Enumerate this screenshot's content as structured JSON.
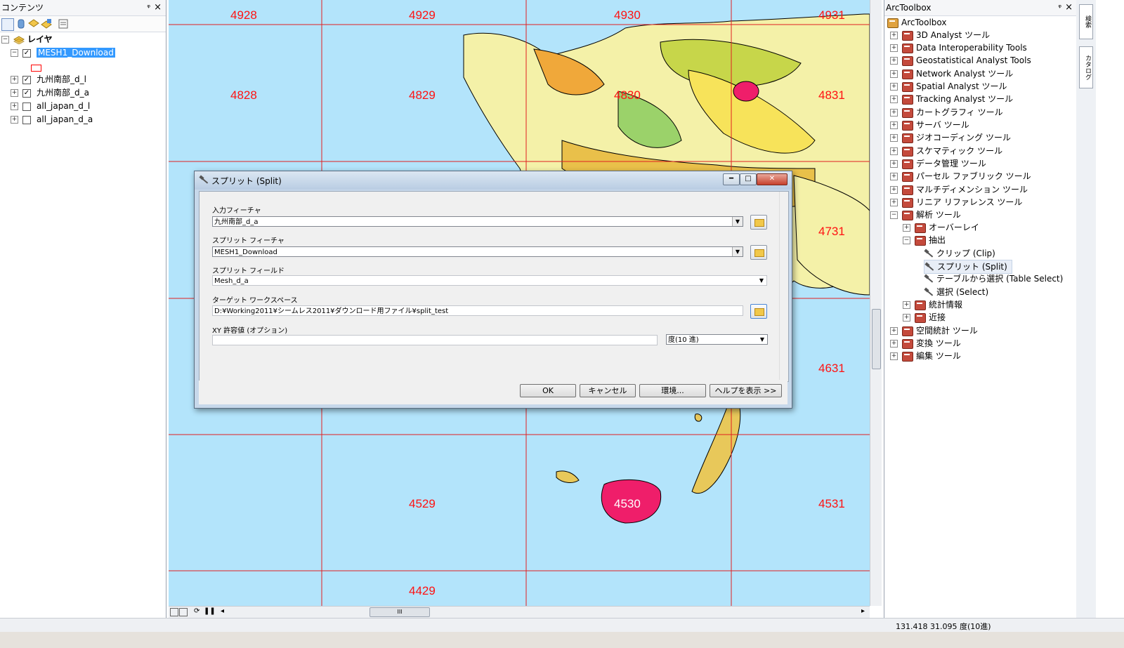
{
  "contents": {
    "title": "コンテンツ",
    "pin": "ᵠ",
    "close": "×",
    "root_label": "レイヤ",
    "layers": [
      {
        "label": "MESH1_Download",
        "checked": "✓",
        "expander": "−",
        "selected": true
      },
      {
        "label": "九州南部_d_l",
        "checked": "✓",
        "expander": "+"
      },
      {
        "label": "九州南部_d_a",
        "checked": "✓",
        "expander": "+"
      },
      {
        "label": "all_japan_d_l",
        "checked": "",
        "expander": "+"
      },
      {
        "label": "all_japan_d_a",
        "checked": "",
        "expander": "+"
      }
    ],
    "legend_symbol_color": "#ff0000"
  },
  "map": {
    "mesh_labels": [
      "4928",
      "4929",
      "4930",
      "4931",
      "4828",
      "4829",
      "4830",
      "4831",
      "4731",
      "4631",
      "4529",
      "4530",
      "4531",
      "4429"
    ],
    "grid_color": "#e02020",
    "sea_color": "#b3e4fb",
    "scroll_thumb": "III"
  },
  "dialog": {
    "title": "スプリット (Split)",
    "input_feature_label": "入力フィーチャ",
    "input_feature_value": "九州南部_d_a",
    "split_feature_label": "スプリット フィーチャ",
    "split_feature_value": "MESH1_Download",
    "split_field_label": "スプリット フィールド",
    "split_field_value": "Mesh_d_a",
    "workspace_label": "ターゲット ワークスペース",
    "workspace_value": "D:¥Working2011¥シームレス2011¥ダウンロード用ファイル¥split_test",
    "xy_tolerance_label": "XY 許容値 (オプション)",
    "xy_tolerance_value": "",
    "unit_value": "度(10 進)",
    "buttons": {
      "ok": "OK",
      "cancel": "キャンセル",
      "env": "環境...",
      "help": "ヘルプを表示 >>"
    },
    "win_min": "━",
    "win_max": "□",
    "win_close": "✕"
  },
  "toolbox": {
    "title": "ArcToolbox",
    "pin": "ᵠ",
    "close": "×",
    "root": "ArcToolbox",
    "items": [
      "3D Analyst ツール",
      "Data Interoperability Tools",
      "Geostatistical Analyst Tools",
      "Network Analyst ツール",
      "Spatial Analyst ツール",
      "Tracking Analyst ツール",
      "カートグラフィ ツール",
      "サーバ ツール",
      "ジオコーディング ツール",
      "スケマティック ツール",
      "データ管理 ツール",
      "パーセル ファブリック ツール",
      "マルチディメンション ツール",
      "リニア リファレンス ツール",
      "解析 ツール"
    ],
    "analysis_children": {
      "overlay": "オーバーレイ",
      "extract": "抽出",
      "extract_tools": [
        "クリップ (Clip)",
        "スプリット (Split)",
        "テーブルから選択 (Table Select)",
        "選択 (Select)"
      ],
      "statistics": "統計情報",
      "proximity": "近接"
    },
    "after_items": [
      "空間統計 ツール",
      "変換 ツール",
      "編集 ツール"
    ]
  },
  "sidetabs": {
    "search": "検索",
    "catalog": "カタログ"
  },
  "status": {
    "coordinates": "131.418  31.095 度(10進)"
  }
}
